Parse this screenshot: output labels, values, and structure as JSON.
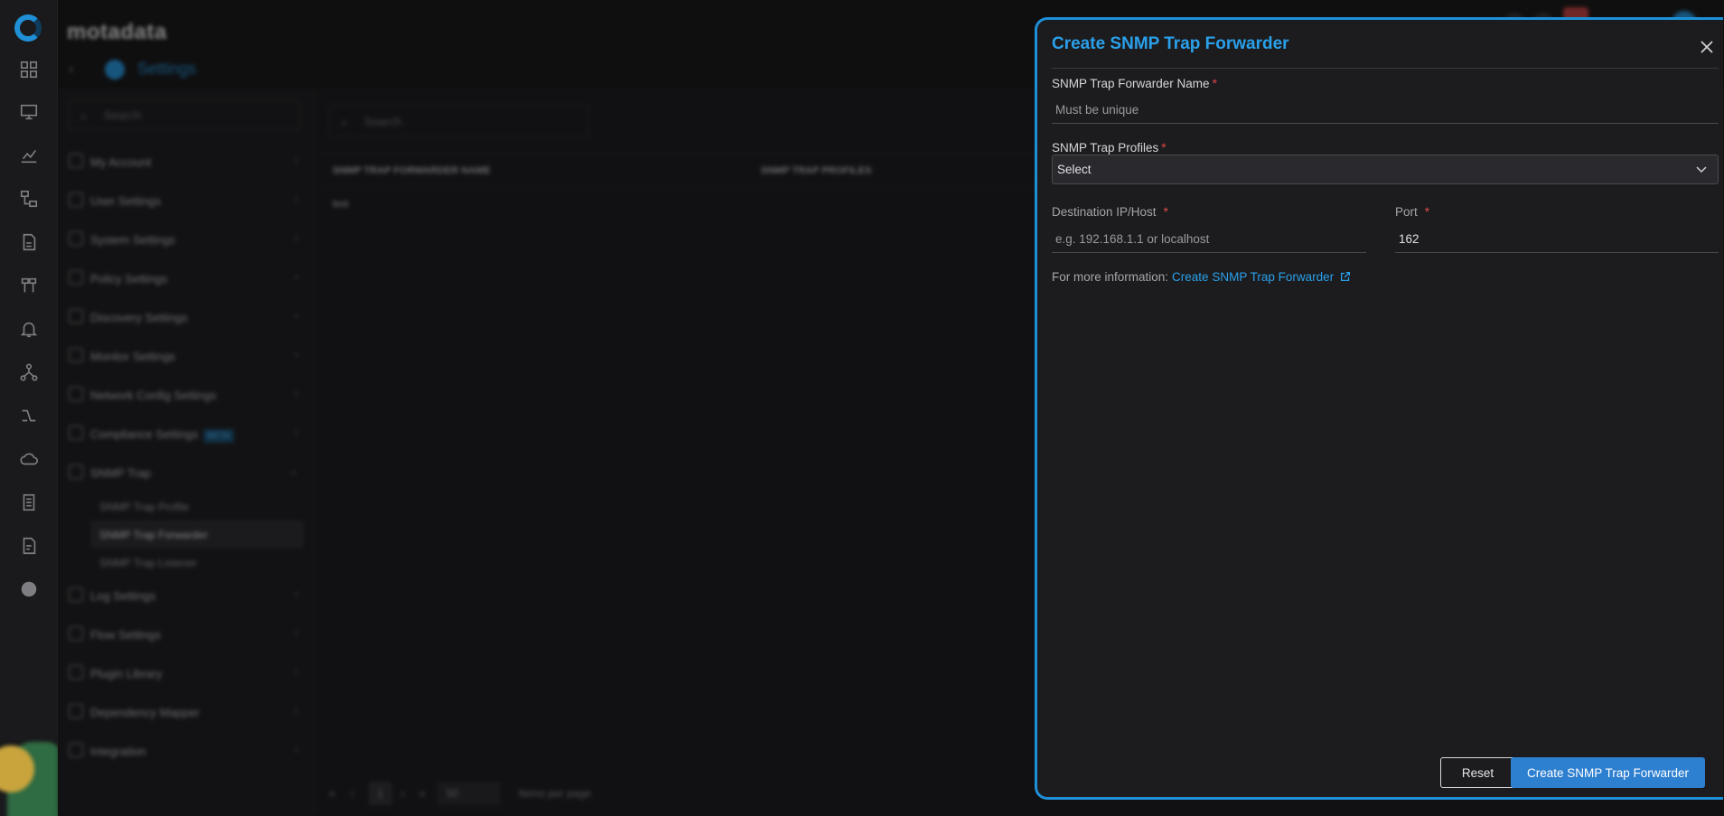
{
  "app": {
    "brand": "motadata",
    "section_title": "Settings"
  },
  "sidebar": {
    "search_placeholder": "Search",
    "items": [
      {
        "label": "My Account"
      },
      {
        "label": "User Settings"
      },
      {
        "label": "System Settings"
      },
      {
        "label": "Policy Settings"
      },
      {
        "label": "Discovery Settings"
      },
      {
        "label": "Monitor Settings"
      },
      {
        "label": "Network Config Settings"
      },
      {
        "label": "Compliance Settings",
        "badge": "BETA"
      },
      {
        "label": "SNMP Trap"
      }
    ],
    "sub_items": [
      {
        "label": "SNMP Trap Profile"
      },
      {
        "label": "SNMP Trap Forwarder"
      },
      {
        "label": "SNMP Trap Listener"
      }
    ],
    "items_after": [
      {
        "label": "Log Settings"
      },
      {
        "label": "Flow Settings"
      },
      {
        "label": "Plugin Library"
      },
      {
        "label": "Dependency Mapper"
      },
      {
        "label": "Integration"
      }
    ]
  },
  "main": {
    "search_placeholder": "Search",
    "columns": [
      "SNMP TRAP FORWARDER NAME",
      "SNMP TRAP PROFILES"
    ],
    "rows": [
      [
        "test",
        ""
      ]
    ],
    "pager": {
      "current_page": "1",
      "per_page": "50",
      "per_page_label": "Items per page"
    }
  },
  "drawer": {
    "title": "Create SNMP Trap Forwarder",
    "name_field": {
      "label": "SNMP Trap Forwarder Name",
      "required": "*",
      "placeholder": "Must be unique",
      "value": ""
    },
    "profiles_field": {
      "label": "SNMP Trap Profiles",
      "required": "*",
      "selected": "Select"
    },
    "destination_field": {
      "label": "Destination IP/Host",
      "required": "*",
      "placeholder": "e.g. 192.168.1.1 or localhost",
      "value": ""
    },
    "port_field": {
      "label": "Port",
      "required": "*",
      "value": "162"
    },
    "info": {
      "prefix": "For more information:",
      "link_text": "Create SNMP Trap Forwarder"
    },
    "reset_label": "Reset",
    "submit_label": "Create SNMP Trap Forwarder"
  },
  "colors": {
    "accent": "#1e90d8",
    "primary_button": "#2d7fd0",
    "required": "#e04848",
    "background": "#1c1c1e"
  },
  "icons": [
    "logo-icon",
    "dashboard-icon",
    "monitor-icon",
    "chart-icon",
    "topology-icon",
    "report-icon",
    "network-icon",
    "alert-icon",
    "hierarchy-icon",
    "flow-icon",
    "cloud-icon",
    "document-icon",
    "file-icon",
    "settings-icon",
    "close-icon",
    "chevron-down-icon",
    "external-link-icon"
  ]
}
